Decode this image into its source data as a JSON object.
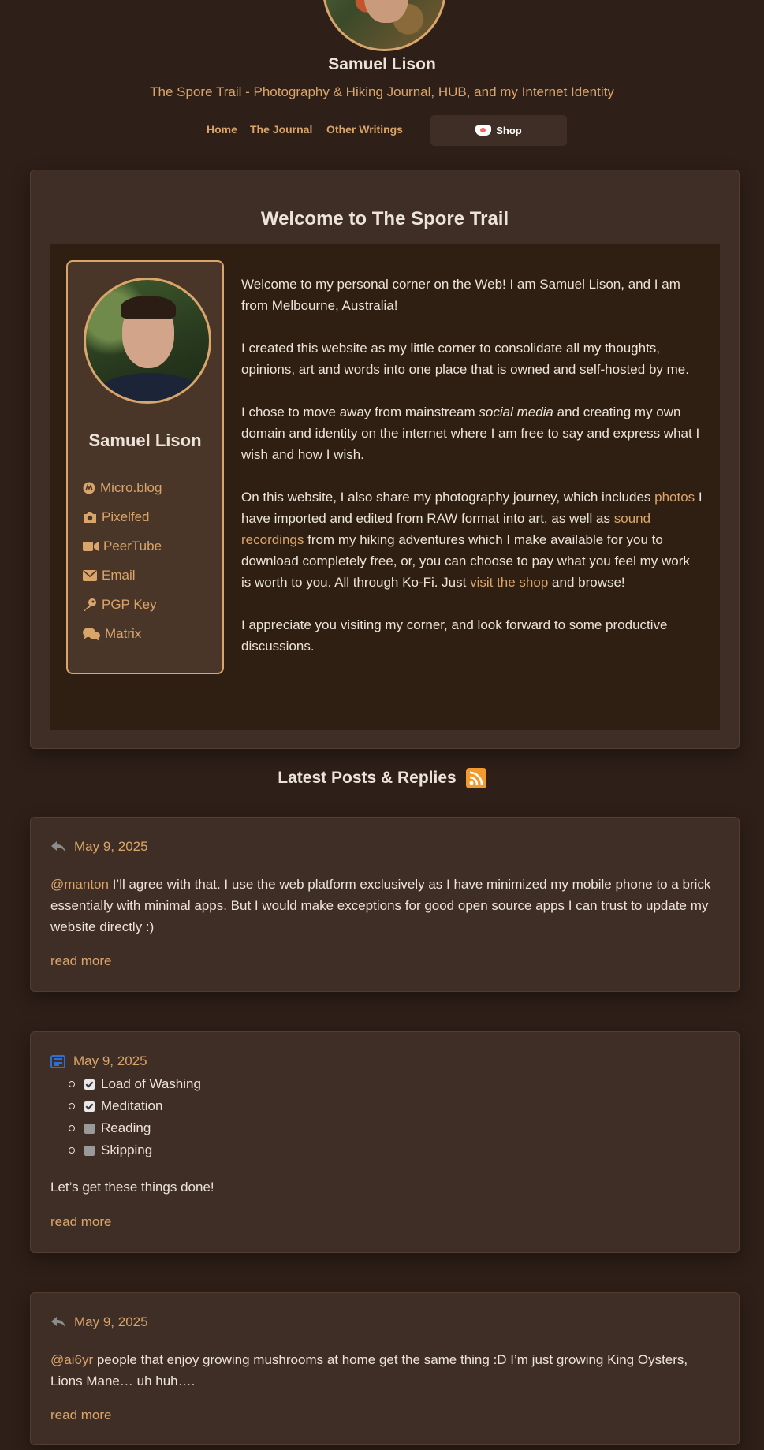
{
  "header": {
    "site_name": "Samuel Lison",
    "tagline": "The Spore Trail - Photography & Hiking Journal, HUB, and my Internet Identity",
    "nav": [
      {
        "label": "Home"
      },
      {
        "label": "The Journal"
      },
      {
        "label": "Other Writings"
      }
    ],
    "shop_label": "Shop"
  },
  "welcome": {
    "title": "Welcome to The Spore Trail",
    "profile_name": "Samuel Lison",
    "links": [
      {
        "label": "Micro.blog",
        "icon": "microblog-icon"
      },
      {
        "label": "Pixelfed",
        "icon": "camera-icon"
      },
      {
        "label": "PeerTube",
        "icon": "video-icon"
      },
      {
        "label": "Email",
        "icon": "envelope-icon"
      },
      {
        "label": "PGP Key",
        "icon": "key-icon"
      },
      {
        "label": "Matrix",
        "icon": "chat-icon"
      }
    ],
    "p1": "Welcome to my personal corner on the Web! I am Samuel Lison, and I am from Melbourne, Australia!",
    "p2": "I created this website as my little corner to consolidate all my thoughts, opinions, art and words into one place that is owned and self-hosted by me.",
    "p3_a": "I chose to move away from mainstream ",
    "p3_em": "social media",
    "p3_b": " and creating my own domain and identity on the internet where I am free to say and express what I wish and how I wish.",
    "p4_a": "On this website, I also share my photography journey, which includes ",
    "p4_link1": "photos",
    "p4_b": " I have imported and edited from RAW format into art, as well as ",
    "p4_link2": "sound recordings",
    "p4_c": " from my hiking adventures which I make available for you to download completely free, or, you can choose to pay what you feel my work is worth to you. All through Ko-Fi. Just ",
    "p4_link3": "visit the shop",
    "p4_d": " and browse!",
    "p5": "I appreciate you visiting my corner, and look forward to some productive discussions."
  },
  "latest": {
    "heading": "Latest Posts & Replies",
    "posts": [
      {
        "icon": "reply-icon",
        "date": "May 9, 2025",
        "mention": "@manton",
        "text": " I’ll agree with that. I use the web platform exclusively as I have minimized my mobile phone to a brick essentially with minimal apps. But I would make exceptions for good open source apps I can trust to update my website directly :)",
        "read_more": "read more"
      },
      {
        "icon": "journal-icon",
        "date": "May 9, 2025",
        "checklist": [
          {
            "label": "Load of Washing",
            "checked": true
          },
          {
            "label": "Meditation",
            "checked": true
          },
          {
            "label": "Reading",
            "checked": false
          },
          {
            "label": "Skipping",
            "checked": false
          }
        ],
        "text": "Let’s get these things done!",
        "read_more": "read more"
      },
      {
        "icon": "reply-icon",
        "date": "May 9, 2025",
        "mention": "@ai6yr",
        "text": " people that enjoy growing mushrooms at home get the same thing :D I’m just growing King Oysters, Lions Mane… uh huh….",
        "read_more": "read more"
      }
    ]
  },
  "colors": {
    "background": "#2e1f18",
    "card": "#3f2e25",
    "accent": "#d9a56b",
    "journal_icon": "#2e6fd1",
    "rss": "#f29a2e"
  }
}
